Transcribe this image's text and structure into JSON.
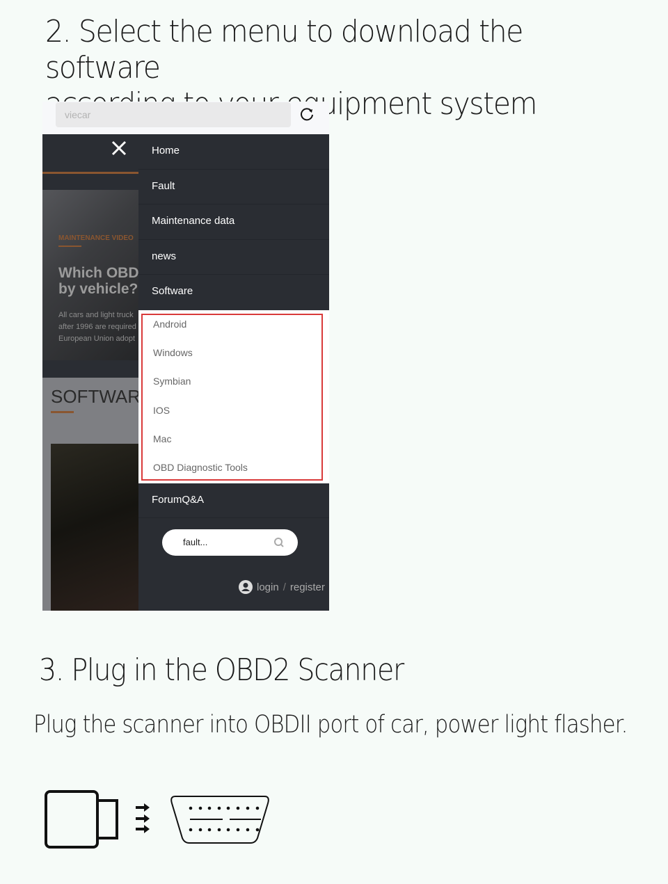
{
  "step2": {
    "title_line1": "2. Select the menu to download the software",
    "title_line2": "according to your equipment system"
  },
  "browser": {
    "address_value": "viecar",
    "reload_icon": "reload-icon"
  },
  "background_page": {
    "category": "MAINTENANCE VIDEO",
    "headline_line1": "Which OBD",
    "headline_line2": "by vehicle?",
    "body_lines": [
      "All cars and light truck",
      "after 1996 are required",
      "European Union adopt"
    ],
    "section_title": "SOFTWARE"
  },
  "menu": {
    "items": [
      "Home",
      "Fault",
      "Maintenance data",
      "news",
      "Software"
    ],
    "software_submenu": [
      "Android",
      "Windows",
      "Symbian",
      "IOS",
      "Mac",
      "OBD Diagnostic Tools"
    ],
    "forum": "ForumQ&A",
    "search_placeholder": "fault...",
    "login": "login",
    "separator": "/",
    "register": "register",
    "highlight_color": "#d93a3a"
  },
  "step3": {
    "title": "3. Plug in the OBD2 Scanner",
    "description": "Plug the scanner into OBDII port of car, power light flasher."
  }
}
